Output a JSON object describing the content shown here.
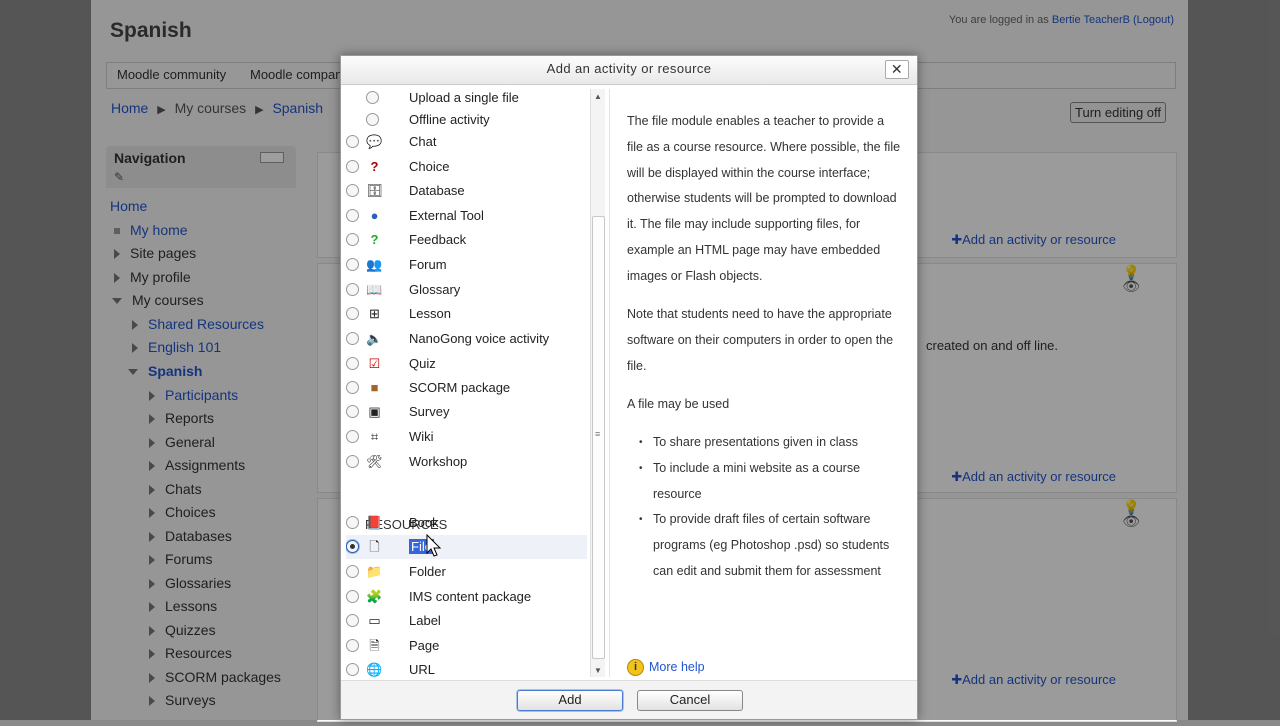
{
  "page": {
    "course_title": "Spanish",
    "login_text": "You are logged in as",
    "login_user": "Bertie TeacherB",
    "logout": "(Logout)",
    "custom_menu": [
      "Moodle community",
      "Moodle companies"
    ],
    "breadcrumb": [
      "Home",
      "My courses",
      "Spanish"
    ],
    "turn_editing": "Turn editing off",
    "add_activity": "Add an activity or resource",
    "section_text": "created on and off line."
  },
  "navigation": {
    "title": "Navigation",
    "items": [
      {
        "label": "Home"
      },
      {
        "label": "My home"
      },
      {
        "label": "Site pages"
      },
      {
        "label": "My profile"
      },
      {
        "label": "My courses"
      },
      {
        "label": "Shared Resources"
      },
      {
        "label": "English 101"
      },
      {
        "label": "Spanish"
      },
      {
        "label": "Participants"
      },
      {
        "label": "Reports"
      },
      {
        "label": "General"
      },
      {
        "label": "Assignments"
      },
      {
        "label": "Chats"
      },
      {
        "label": "Choices"
      },
      {
        "label": "Databases"
      },
      {
        "label": "Forums"
      },
      {
        "label": "Glossaries"
      },
      {
        "label": "Lessons"
      },
      {
        "label": "Quizzes"
      },
      {
        "label": "Resources"
      },
      {
        "label": "SCORM packages"
      },
      {
        "label": "Surveys"
      }
    ]
  },
  "modal": {
    "title": "Add an activity or resource",
    "close": "✕",
    "activities": [
      {
        "label": "Upload a single file",
        "icon": "none"
      },
      {
        "label": "Offline activity",
        "icon": "none"
      },
      {
        "label": "Chat",
        "icon": "chat-icon"
      },
      {
        "label": "Choice",
        "icon": "choice-icon"
      },
      {
        "label": "Database",
        "icon": "database-icon"
      },
      {
        "label": "External Tool",
        "icon": "external-tool-icon"
      },
      {
        "label": "Feedback",
        "icon": "feedback-icon"
      },
      {
        "label": "Forum",
        "icon": "forum-icon"
      },
      {
        "label": "Glossary",
        "icon": "glossary-icon"
      },
      {
        "label": "Lesson",
        "icon": "lesson-icon"
      },
      {
        "label": "NanoGong voice activity",
        "icon": "nanogong-icon"
      },
      {
        "label": "Quiz",
        "icon": "quiz-icon"
      },
      {
        "label": "SCORM package",
        "icon": "scorm-icon"
      },
      {
        "label": "Survey",
        "icon": "survey-icon"
      },
      {
        "label": "Wiki",
        "icon": "wiki-icon"
      },
      {
        "label": "Workshop",
        "icon": "workshop-icon"
      }
    ],
    "resources_header": "RESOURCES",
    "resources": [
      {
        "label": "Book",
        "icon": "book-icon"
      },
      {
        "label": "File",
        "icon": "file-icon",
        "selected": true
      },
      {
        "label": "Folder",
        "icon": "folder-icon"
      },
      {
        "label": "IMS content package",
        "icon": "ims-icon"
      },
      {
        "label": "Label",
        "icon": "label-icon"
      },
      {
        "label": "Page",
        "icon": "page-icon"
      },
      {
        "label": "URL",
        "icon": "url-icon"
      }
    ],
    "help": {
      "p1": "The file module enables a teacher to provide a file as a course resource. Where possible, the file will be displayed within the course interface; otherwise students will be prompted to download it. The file may include supporting files, for example an HTML page may have embedded images or Flash objects.",
      "p2": "Note that students need to have the appropriate software on their computers in order to open the file.",
      "p3": "A file may be used",
      "bullets": [
        "To share presentations given in class",
        "To include a mini website as a course resource",
        "To provide draft files of certain software programs (eg Photoshop .psd) so students can edit and submit them for assessment"
      ],
      "more_help": "More help"
    },
    "add_button": "Add",
    "cancel_button": "Cancel"
  },
  "colors": {
    "link": "#2255cc",
    "selection": "#3366dd"
  }
}
